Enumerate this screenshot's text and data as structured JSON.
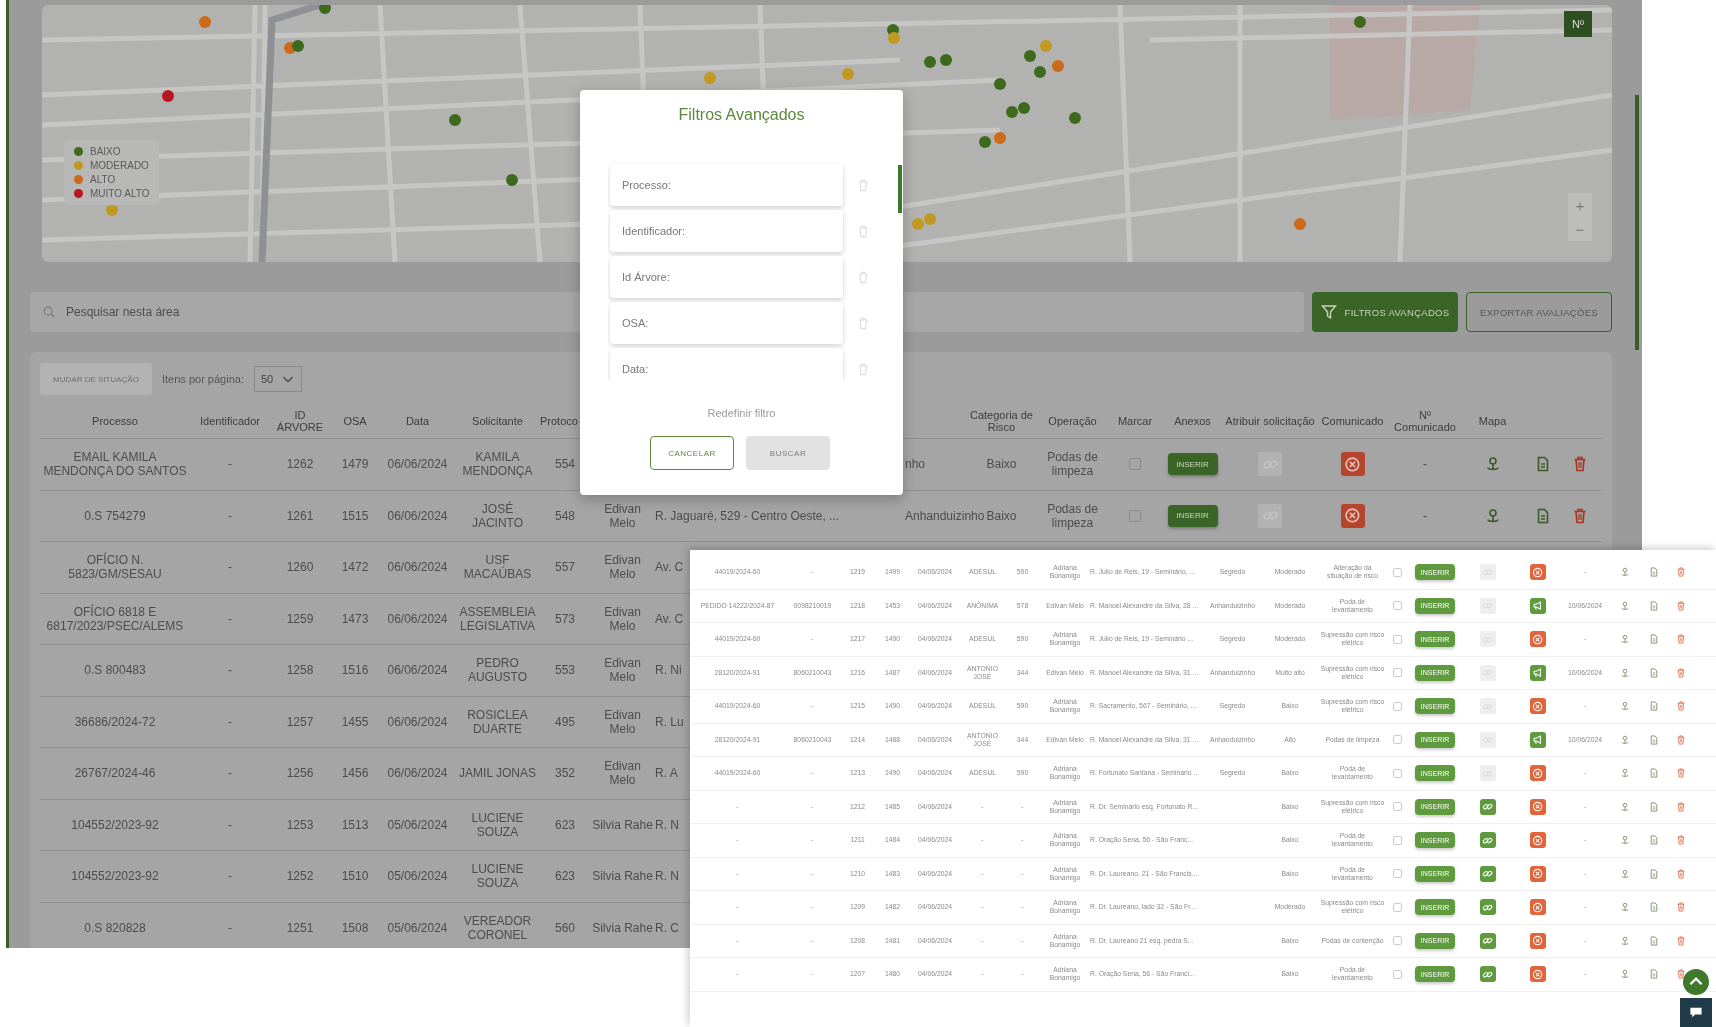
{
  "map": {
    "legend": [
      {
        "label": "BAIXO",
        "color": "#3d6a1c"
      },
      {
        "label": "MODERADO",
        "color": "#c09a20"
      },
      {
        "label": "ALTO",
        "color": "#cc6a1a"
      },
      {
        "label": "MUITO ALTO",
        "color": "#b8161c"
      }
    ],
    "number_button": "Nº",
    "zoom_in": "+",
    "zoom_out": "−"
  },
  "search": {
    "placeholder": "Pesquisar nesta área"
  },
  "actions": [
    {
      "label": "FILTROS AVANÇADOS",
      "kind": "primary"
    },
    {
      "label": "EXPORTAR AVALIAÇÕES",
      "kind": "outline"
    }
  ],
  "table": {
    "bulk_button": {
      "label": "MUDAR DE SITUAÇÃO",
      "disabled": true
    },
    "per_page_label": "Itens por página:",
    "per_page": "50",
    "columns": {
      "processo": "Processo",
      "identificador": "Identificador",
      "id_arvore": "ID ÁRVORE",
      "osa": "OSA",
      "data": "Data",
      "solicitante": "Solicitante",
      "protocolo": "Protoco",
      "categoria_risco": "Categoria de Risco",
      "operacao": "Operação",
      "marcar": "Marcar",
      "anexos": "Anexos",
      "atribuir": "Atribuir solicitação",
      "comunicado": "Comunicado",
      "n_comunicado": "Nº Comunicado",
      "mapa": "Mapa"
    },
    "rows": [
      {
        "processo": "EMAIL KAMILA MENDONÇA DO SANTOS",
        "identificador": "-",
        "id_arvore": "1262",
        "osa": "1479",
        "data": "06/06/2024",
        "solicitante": "KAMILA MENDONÇA",
        "protocolo": "554",
        "bairro": "nho",
        "categoria_risco": "Baixo",
        "operacao": "Podas de limpeza",
        "marcar": false,
        "anexos": "INSERIR",
        "assignable": false,
        "sent": false,
        "n_comunicado": "-"
      },
      {
        "processo": "0.S 754279",
        "identificador": "-",
        "id_arvore": "1261",
        "osa": "1515",
        "data": "06/06/2024",
        "solicitante": "JOSÉ JACINTO",
        "protocolo": "548",
        "responsavel": "Edivan Melo",
        "endereco": "R. Jaguaré, 529 - Centro Oeste, ...",
        "bairro": "Anhanduizinho",
        "categoria_risco": "Baixo",
        "operacao": "Podas de limpeza",
        "marcar": false,
        "anexos": "INSERIR",
        "assignable": false,
        "sent": false,
        "n_comunicado": "-"
      },
      {
        "processo": "OFÍCIO N. 5823/GM/SESAU",
        "identificador": "-",
        "id_arvore": "1260",
        "osa": "1472",
        "data": "06/06/2024",
        "solicitante": "USF MACAÚBAS",
        "protocolo": "557",
        "responsavel": "Edivan Melo",
        "endereco": "Av. C"
      },
      {
        "processo": "OFÍCIO 6818 E 6817/2023/PSEC/ALEMS",
        "identificador": "-",
        "id_arvore": "1259",
        "osa": "1473",
        "data": "06/06/2024",
        "solicitante": "ASSEMBLEIA LEGISLATIVA",
        "protocolo": "573",
        "responsavel": "Edivan Melo",
        "endereco": "Av. C"
      },
      {
        "processo": "0.S 800483",
        "identificador": "-",
        "id_arvore": "1258",
        "osa": "1516",
        "data": "06/06/2024",
        "solicitante": "PEDRO AUGUSTO",
        "protocolo": "553",
        "responsavel": "Edivan Melo",
        "endereco": "R. Ni"
      },
      {
        "processo": "36686/2024-72",
        "identificador": "-",
        "id_arvore": "1257",
        "osa": "1455",
        "data": "06/06/2024",
        "solicitante": "ROSICLEA DUARTE",
        "protocolo": "495",
        "responsavel": "Edivan Melo",
        "endereco": "R. Lu"
      },
      {
        "processo": "26767/2024-46",
        "identificador": "-",
        "id_arvore": "1256",
        "osa": "1456",
        "data": "06/06/2024",
        "solicitante": "JAMIL JONAS",
        "protocolo": "352",
        "responsavel": "Edivan Melo",
        "endereco": "R. A"
      },
      {
        "processo": "104552/2023-92",
        "identificador": "-",
        "id_arvore": "1253",
        "osa": "1513",
        "data": "05/06/2024",
        "solicitante": "LUCIENE SOUZA",
        "protocolo": "623",
        "responsavel": "Silvia Rahe",
        "endereco": "R. N"
      },
      {
        "processo": "104552/2023-92",
        "identificador": "-",
        "id_arvore": "1252",
        "osa": "1510",
        "data": "05/06/2024",
        "solicitante": "LUCIENE SOUZA",
        "protocolo": "623",
        "responsavel": "Silvia Rahe",
        "endereco": "R. N"
      },
      {
        "processo": "0.S 820828",
        "identificador": "-",
        "id_arvore": "1251",
        "osa": "1508",
        "data": "05/06/2024",
        "solicitante": "VEREADOR CORONEL",
        "protocolo": "560",
        "responsavel": "Silvia Rahe",
        "endereco": "R. C"
      }
    ]
  },
  "modal": {
    "title": "Filtros Avançados",
    "fields": [
      {
        "placeholder": "Processo:"
      },
      {
        "placeholder": "Identificador:"
      },
      {
        "placeholder": "Id Árvore:"
      },
      {
        "placeholder": "OSA:"
      },
      {
        "placeholder": "Data:"
      }
    ],
    "reset_link": "Redefinir filtro",
    "buttons": [
      {
        "label": "CANCELAR",
        "disabled": false
      },
      {
        "label": "BUSCAR",
        "disabled": true
      }
    ]
  },
  "inset": {
    "rows": [
      {
        "processo": "44019/2024-60",
        "identificador": "-",
        "id_arvore": "1219",
        "osa": "1499",
        "data": "04/06/2024",
        "solicitante": "ADESUL",
        "protocolo": "590",
        "responsavel": "Adriana Bonamigo",
        "endereco": "R. Júlio de Reis, 19 - Seminário, ...",
        "bairro": "Segredo",
        "categoria_risco": "Moderado",
        "operacao": "Alteração da situação de risco",
        "marcar": false,
        "anexos": "INSERIR",
        "assignable": false,
        "sent": false,
        "n_comunicado": "-"
      },
      {
        "processo": "PEDIDO 14222/2024-87",
        "identificador": "0098210019",
        "id_arvore": "1218",
        "osa": "1453",
        "data": "04/06/2024",
        "solicitante": "ANÔNIMA",
        "protocolo": "578",
        "responsavel": "Edivan Melo",
        "endereco": "R. Manoel Alexandre da Silva, 28 ...",
        "bairro": "Anhanduizinho",
        "categoria_risco": "Moderado",
        "operacao": "Poda de levantamento",
        "marcar": false,
        "anexos": "INSERIR",
        "assignable": false,
        "sent": true,
        "n_comunicado": "10/06/2024"
      },
      {
        "processo": "44019/2024-60",
        "identificador": "-",
        "id_arvore": "1217",
        "osa": "1490",
        "data": "04/06/2024",
        "solicitante": "ADESUL",
        "protocolo": "590",
        "responsavel": "Adriana Bonamigo",
        "endereco": "R. Júlio de Reis, 19 - Seminário ...",
        "bairro": "Segredo",
        "categoria_risco": "Moderado",
        "operacao": "Supressão com risco elétrico",
        "marcar": false,
        "anexos": "INSERIR",
        "assignable": false,
        "sent": false,
        "n_comunicado": "-"
      },
      {
        "processo": "28120/2024-91",
        "identificador": "8060210043",
        "id_arvore": "1216",
        "osa": "1487",
        "data": "04/06/2024",
        "solicitante": "ANTONIO JOSÉ",
        "protocolo": "344",
        "responsavel": "Edivan Melo",
        "endereco": "R. Manoel Alexandre da Silva, 31 ...",
        "bairro": "Anhanduizinho",
        "categoria_risco": "Muito alto",
        "operacao": "Supressão com risco elétrico",
        "marcar": false,
        "anexos": "INSERIR",
        "assignable": false,
        "sent": true,
        "n_comunicado": "10/06/2024"
      },
      {
        "processo": "44019/2024-60",
        "identificador": "-",
        "id_arvore": "1215",
        "osa": "1490",
        "data": "04/06/2024",
        "solicitante": "ADESUL",
        "protocolo": "590",
        "responsavel": "Adriana Bonamigo",
        "endereco": "R. Sacramento, 567 - Seminário, ...",
        "bairro": "Segredo",
        "categoria_risco": "Baixo",
        "operacao": "Supressão com risco elétrico",
        "marcar": false,
        "anexos": "INSERIR",
        "assignable": false,
        "sent": false,
        "n_comunicado": "-"
      },
      {
        "processo": "28120/2024-91",
        "identificador": "8060210043",
        "id_arvore": "1214",
        "osa": "1488",
        "data": "04/06/2024",
        "solicitante": "ANTONIO JOSÉ",
        "protocolo": "344",
        "responsavel": "Edivan Melo",
        "endereco": "R. Manoel Alexandre da Silva, 31 ...",
        "bairro": "Anhanduizinho",
        "categoria_risco": "Alto",
        "operacao": "Podas de limpeza",
        "marcar": false,
        "anexos": "INSERIR",
        "assignable": false,
        "sent": true,
        "n_comunicado": "10/06/2024"
      },
      {
        "processo": "44019/2024-60",
        "identificador": "-",
        "id_arvore": "1213",
        "osa": "1490",
        "data": "04/06/2024",
        "solicitante": "ADESUL",
        "protocolo": "590",
        "responsavel": "Adriana Bonamigo",
        "endereco": "R. Fortunato Santana - Seminário ...",
        "bairro": "Segredo",
        "categoria_risco": "Baixo",
        "operacao": "Poda de levantamento",
        "marcar": false,
        "anexos": "INSERIR",
        "assignable": false,
        "sent": false,
        "n_comunicado": "-"
      },
      {
        "processo": "-",
        "identificador": "-",
        "id_arvore": "1212",
        "osa": "1485",
        "data": "04/06/2024",
        "solicitante": "-",
        "protocolo": "-",
        "responsavel": "Adriana Bonamigo",
        "endereco": "R. Dr. Seminário esq. Fortunato R...",
        "categoria_risco": "Baixo",
        "operacao": "Supressão com risco elétrico",
        "marcar": false,
        "anexos": "INSERIR",
        "assignable": true,
        "sent": false,
        "n_comunicado": "-"
      },
      {
        "processo": "-",
        "identificador": "-",
        "id_arvore": "1211",
        "osa": "1484",
        "data": "04/06/2024",
        "solicitante": "-",
        "protocolo": "-",
        "responsavel": "Adriana Bonamigo",
        "endereco": "R. Oração Sena, 56 - São Franc...",
        "categoria_risco": "Baixo",
        "operacao": "Poda de levantamento",
        "marcar": false,
        "anexos": "INSERIR",
        "assignable": true,
        "sent": false,
        "n_comunicado": "-"
      },
      {
        "processo": "-",
        "identificador": "-",
        "id_arvore": "1210",
        "osa": "1483",
        "data": "04/06/2024",
        "solicitante": "-",
        "protocolo": "-",
        "responsavel": "Adriana Bonamigo",
        "endereco": "R. Dr. Laureano, 21 - São Francis...",
        "categoria_risco": "Baixo",
        "operacao": "Poda de levantamento",
        "marcar": false,
        "anexos": "INSERIR",
        "assignable": true,
        "sent": false,
        "n_comunicado": "-"
      },
      {
        "processo": "-",
        "identificador": "-",
        "id_arvore": "1209",
        "osa": "1482",
        "data": "04/06/2024",
        "solicitante": "-",
        "protocolo": "-",
        "responsavel": "Adriana Bonamigo",
        "endereco": "R. Dr. Laureano, lado 32 - São Fr...",
        "categoria_risco": "Moderado",
        "operacao": "Supressão com risco elétrico",
        "marcar": false,
        "anexos": "INSERIR",
        "assignable": true,
        "sent": false,
        "n_comunicado": "-"
      },
      {
        "processo": "-",
        "identificador": "-",
        "id_arvore": "1208",
        "osa": "1481",
        "data": "04/06/2024",
        "solicitante": "-",
        "protocolo": "-",
        "responsavel": "Adriana Bonamigo",
        "endereco": "R. Dr. Laureano 21 esq. pedra S...",
        "categoria_risco": "Baixo",
        "operacao": "Podas de contenção",
        "marcar": false,
        "anexos": "INSERIR",
        "assignable": true,
        "sent": false,
        "n_comunicado": "-"
      },
      {
        "processo": "-",
        "identificador": "-",
        "id_arvore": "1207",
        "osa": "1480",
        "data": "04/06/2024",
        "solicitante": "-",
        "protocolo": "-",
        "responsavel": "Adriana Bonamigo",
        "endereco": "R. Oração Sena, 56 - São Franci...",
        "categoria_risco": "Baixo",
        "operacao": "Poda de levantamento",
        "marcar": false,
        "anexos": "INSERIR",
        "assignable": true,
        "sent": false,
        "n_comunicado": "-"
      }
    ]
  }
}
